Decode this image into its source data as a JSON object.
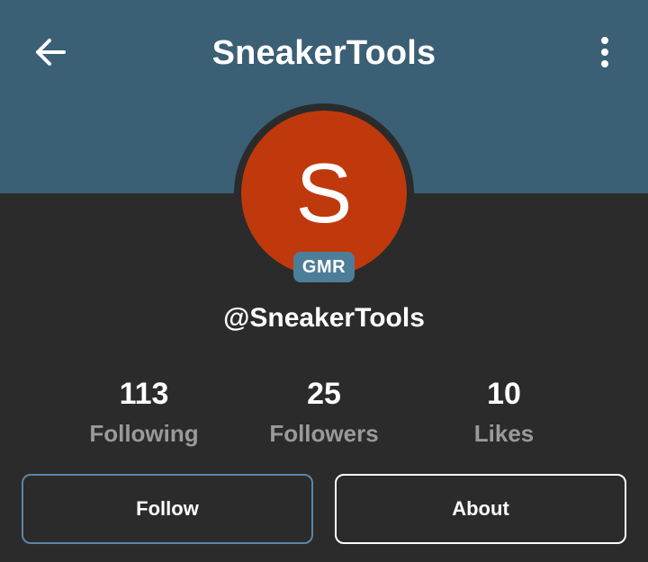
{
  "header": {
    "title": "SneakerTools",
    "background_color": "#3b5f75",
    "back_icon": "arrow-left-icon",
    "menu_icon": "more-vertical-icon"
  },
  "profile": {
    "avatar_letter": "S",
    "avatar_color": "#c0390c",
    "badge": "GMR",
    "badge_color": "#4d7e98",
    "handle": "@SneakerTools"
  },
  "stats": [
    {
      "value": "113",
      "label": "Following"
    },
    {
      "value": "25",
      "label": "Followers"
    },
    {
      "value": "10",
      "label": "Likes"
    }
  ],
  "actions": {
    "follow_label": "Follow",
    "about_label": "About"
  }
}
